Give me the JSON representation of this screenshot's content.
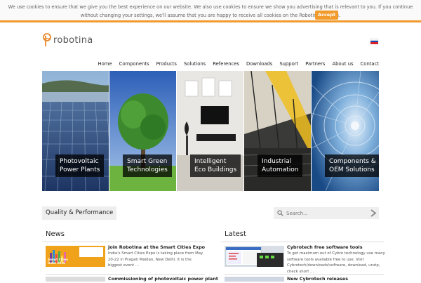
{
  "cookie": {
    "text": "We use cookies to ensure that we give you the best experience on our website. We also use cookies to ensure we show you advertising that is relevant to you. If you continue without changing your settings, we'll assume that you are happy to receive all cookies on the Robotina website.",
    "accept_label": "Accept"
  },
  "header": {
    "logo_text": "robotina",
    "flag": "slovenia-flag-icon"
  },
  "nav": [
    "Home",
    "Components",
    "Products",
    "Solutions",
    "References",
    "Downloads",
    "Support",
    "Partners",
    "About us",
    "Contact"
  ],
  "banner": [
    {
      "line1": "Photovoltaic",
      "line2": "Power Plants"
    },
    {
      "line1": "Smart Green",
      "line2": "Technologies"
    },
    {
      "line1": "Intelligent",
      "line2": "Eco Buildings"
    },
    {
      "line1": "Industrial",
      "line2": "Automation"
    },
    {
      "line1": "Components &",
      "line2": "OEM Solutions"
    }
  ],
  "quality_label": "Quality & Performance",
  "search": {
    "placeholder": "Search..."
  },
  "news": {
    "title": "News",
    "items": [
      {
        "title": "Join Robotina at the Smart Cities Expo",
        "body": "India's Smart Cities Expo is taking place from May 20-22 in Pragati Maidan, New Delhi. It is the biggest event …",
        "thumb_text": "Smart Cities India 2016"
      },
      {
        "title": "Commissioning of photovoltaic power plant"
      }
    ]
  },
  "latest": {
    "title": "Latest",
    "items": [
      {
        "title": "Cybrotech free software tools",
        "body": "To get maximum out of Cybro technology use many software tools available free to use. Visit Cybrotech/downloads/software, download, unzip, check short …"
      },
      {
        "title": "New Cybrotech releases"
      }
    ]
  },
  "colors": {
    "accent": "#f29b2c",
    "caption_bg": "#000000"
  }
}
